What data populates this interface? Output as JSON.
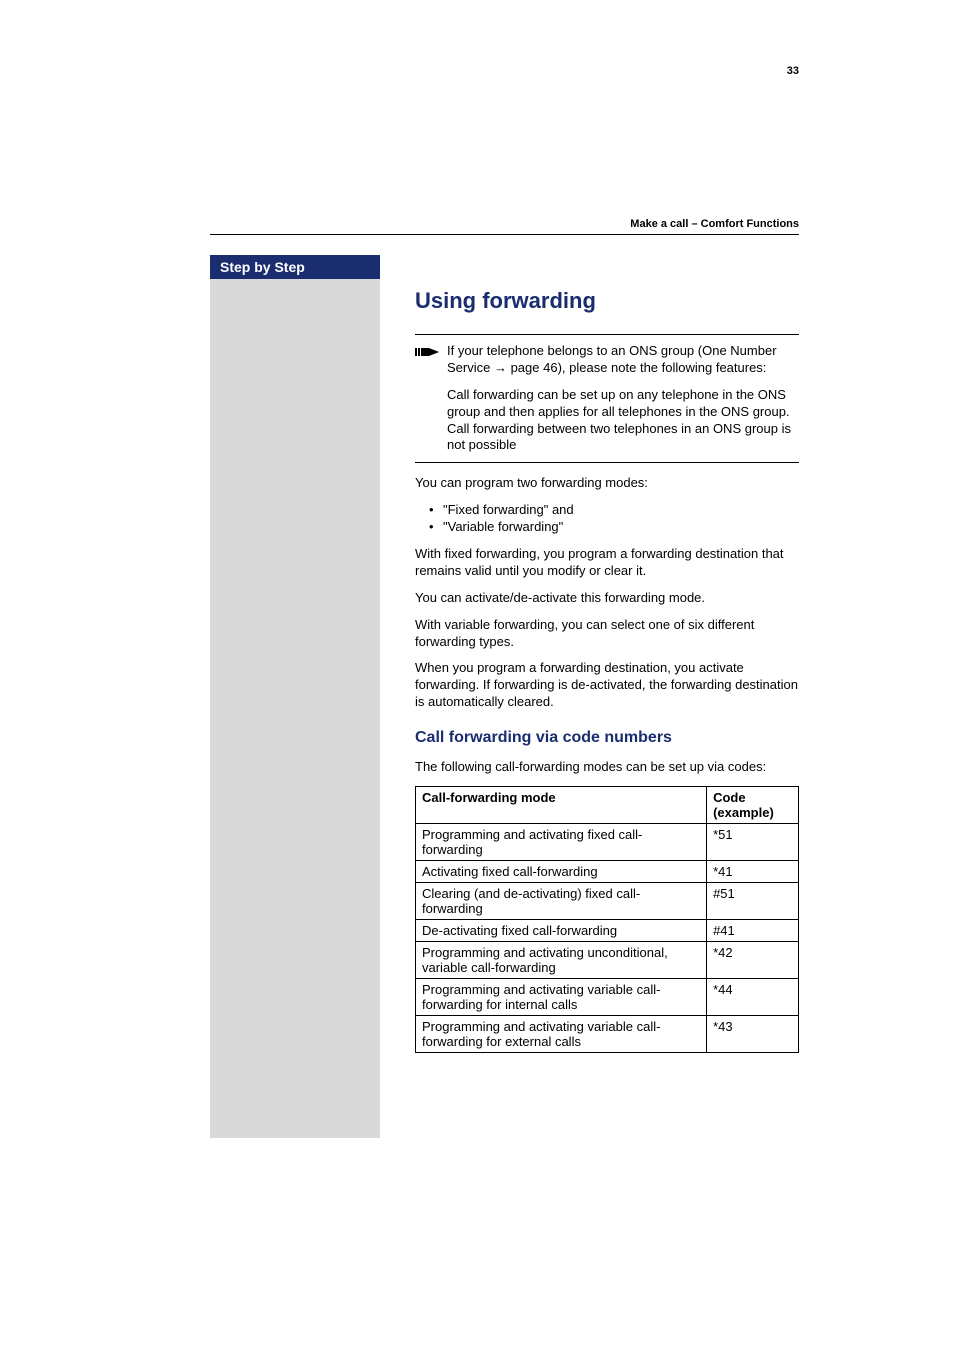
{
  "header": {
    "section": "Make a call – Comfort Functions"
  },
  "sidebar": {
    "title": "Step by Step"
  },
  "main": {
    "h1": "Using forwarding",
    "note": {
      "p1_a": "If your telephone belongs to an ONS group (One Number Service ",
      "p1_b": " page 46), please note the following features:",
      "arrow_glyph": "→",
      "p2": "Call forwarding can be set up on any telephone in the ONS group and then applies for all telephones in the ONS group.",
      "p3": "Call forwarding between two telephones in an ONS group is not possible"
    },
    "para1": "You can program two forwarding modes:",
    "bullets": [
      "\"Fixed forwarding\" and",
      "\"Variable forwarding\""
    ],
    "para2": "With fixed forwarding, you program a forwarding destination that remains valid until you modify or clear it.",
    "para3": "You can activate/de-activate this forwarding mode.",
    "para4": "With variable forwarding, you can select one of six different forwarding types.",
    "para5": "When you program a forwarding destination, you activate forwarding. If forwarding is de-activated, the forwarding destination is automatically cleared.",
    "h2": "Call forwarding via code numbers",
    "para6": "The following call-forwarding modes can be set up via codes:",
    "table": {
      "th_mode": "Call-forwarding mode",
      "th_code": "Code (example)",
      "rows": [
        {
          "mode": "Programming and activating fixed call-forwarding",
          "code": "*51"
        },
        {
          "mode": "Activating fixed call-forwarding",
          "code": "*41"
        },
        {
          "mode": "Clearing (and de-activating) fixed call-forwarding",
          "code": "#51"
        },
        {
          "mode": "De-activating fixed call-forwarding",
          "code": "#41"
        },
        {
          "mode": "Programming and activating unconditional, variable call-forwarding",
          "code": "*42"
        },
        {
          "mode": "Programming and activating variable call-forwarding for internal calls",
          "code": "*44"
        },
        {
          "mode": "Programming and activating variable call-forwarding for external calls",
          "code": "*43"
        }
      ]
    }
  },
  "footer": {
    "page_number": "33"
  }
}
